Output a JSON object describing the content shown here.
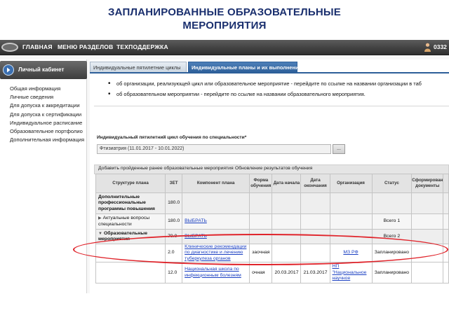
{
  "slide": {
    "title_line1": "ЗАПЛАНИРОВАННЫЕ ОБРАЗОВАТЕЛЬНЫЕ",
    "title_line2": "МЕРОПРИЯТИЯ"
  },
  "topnav": {
    "items": [
      "ГЛАВНАЯ",
      "МЕНЮ РАЗДЕЛОВ",
      "ТЕХПОДДЕРЖКА"
    ],
    "user_code": "0332"
  },
  "sidebar": {
    "header": "Личный кабинет",
    "items": [
      "Общая информация",
      "Личные сведения",
      "Для допуска к аккредитации",
      "Для допуска к сертификации",
      "Индивидуальное расписание",
      "Образовательное портфолио",
      "Дополнительная информация"
    ],
    "active_index": 2
  },
  "tabs": [
    {
      "label": "Индивидуальные пятилетние циклы",
      "active": false
    },
    {
      "label": "Индивидуальные планы и их выполнение",
      "active": true
    }
  ],
  "info_bullets": [
    "об организации, реализующей цикл или образовательное мероприятие - перейдите по ссылке на названии организации в таб",
    "об образовательном мероприятии - перейдите по ссылке на названии образовательного мероприятия."
  ],
  "plan_field": {
    "label": "Индивидуальный пятилетний цикл обучения по специальности*",
    "value": "Фтизиатрия (11.01.2017 - 10.01.2022)",
    "browse_button": "..."
  },
  "subtabs": [
    "Добавить пройденные ранее образовательные мероприятия",
    "Обновление результатов обучения"
  ],
  "table": {
    "headers": [
      "Структуре плана",
      "ЗЕТ",
      "Компонент плана",
      "Форма обучения",
      "Дата начала",
      "Дата окончания",
      "Организация",
      "Статус",
      "Сформирован документы",
      ""
    ],
    "rows": [
      {
        "kind": "group",
        "structure": "Дополнительные профессиональные программы повышения",
        "zet": "180.0",
        "component": "",
        "form": "",
        "start": "",
        "end": "",
        "org": "",
        "status": ""
      },
      {
        "kind": "sub",
        "structure": "Актуальные вопросы специальности",
        "zet": "180.0",
        "component": "ВЫБРАТЬ",
        "form": "",
        "start": "",
        "end": "",
        "org": "",
        "status": "Всего 1"
      },
      {
        "kind": "group",
        "structure": "Образовательные мероприятия",
        "zet": "70.0",
        "component": "ВЫБРАТЬ",
        "form": "",
        "start": "",
        "end": "",
        "org": "",
        "status": "Всего 2"
      },
      {
        "kind": "item",
        "structure": "",
        "zet": "2.0",
        "component": "Клинические рекомендации по диагностике и лечению туберкулеза органов",
        "form": "заочная",
        "start": "",
        "end": "",
        "org": "МЗ РФ",
        "status": "Запланировано"
      },
      {
        "kind": "item",
        "structure": "",
        "zet": "12.0",
        "component": "Национальная школа по инфекционным болезням",
        "form": "очная",
        "start": "20.03.2017",
        "end": "21.03.2017",
        "org": "НП \"Национальное научное",
        "status": "Запланировано"
      }
    ]
  },
  "colors": {
    "title": "#1a2f6e",
    "tab_active": "#2d5f99",
    "link": "#1a3fc2",
    "highlight": "#e0242b"
  }
}
